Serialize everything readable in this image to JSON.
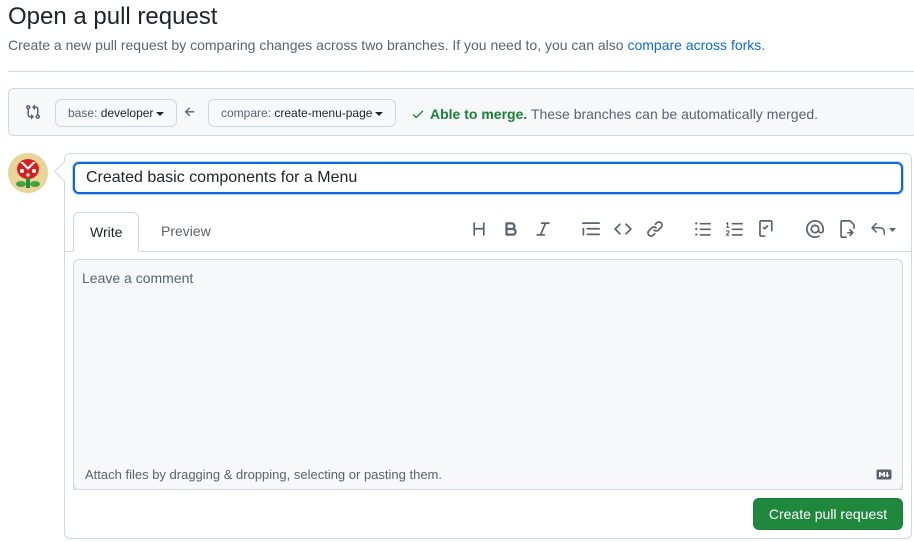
{
  "header": {
    "title": "Open a pull request",
    "subtitle": "Create a new pull request by comparing changes across two branches. If you need to, you can also ",
    "subtitle_link": "compare across forks",
    "subtitle_end": "."
  },
  "range": {
    "base_prefix": "base:",
    "base_branch": "developer",
    "compare_prefix": "compare:",
    "compare_branch": "create-menu-page",
    "merge_ok": "Able to merge.",
    "merge_detail": "These branches can be automatically merged."
  },
  "editor": {
    "title_value": "Created basic components for a Menu",
    "tabs": [
      {
        "label": "Write"
      },
      {
        "label": "Preview"
      }
    ],
    "comment_placeholder": "Leave a comment",
    "attach_hint": "Attach files by dragging & dropping, selecting or pasting them.",
    "submit_label": "Create pull request"
  },
  "toolbar": [
    {
      "icon": "heading-icon"
    },
    {
      "icon": "bold-icon"
    },
    {
      "icon": "italic-icon"
    },
    {
      "icon": "quote-icon"
    },
    {
      "icon": "code-icon"
    },
    {
      "icon": "link-icon"
    },
    {
      "icon": "unordered-list-icon"
    },
    {
      "icon": "ordered-list-icon"
    },
    {
      "icon": "task-list-icon"
    },
    {
      "icon": "mention-icon"
    },
    {
      "icon": "cross-reference-icon"
    },
    {
      "icon": "saved-replies-icon"
    }
  ],
  "colors": {
    "accent": "#0969da",
    "success": "#1a7f37",
    "button": "#1f883d"
  }
}
